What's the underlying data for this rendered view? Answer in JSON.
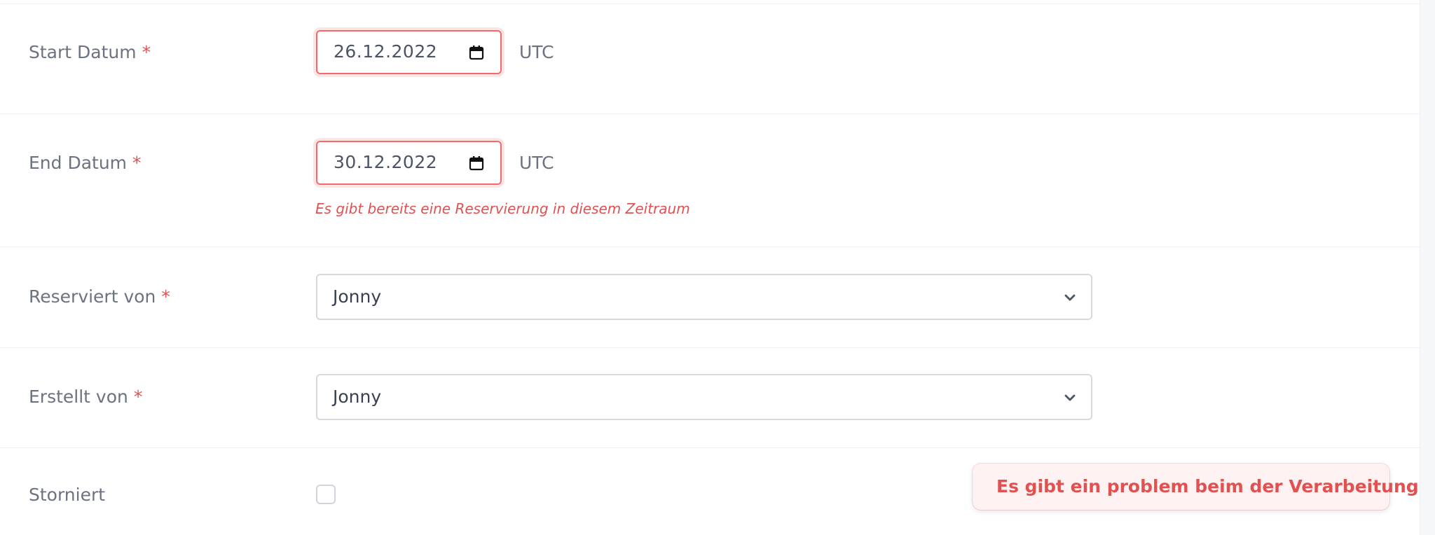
{
  "form": {
    "start_date": {
      "label": "Start Datum",
      "required_mark": "*",
      "value": "26.12.2022",
      "unit": "UTC"
    },
    "end_date": {
      "label": "End Datum",
      "required_mark": "*",
      "value": "30.12.2022",
      "unit": "UTC",
      "error": "Es gibt bereits eine Reservierung in diesem Zeitraum"
    },
    "reserved_by": {
      "label": "Reserviert von",
      "required_mark": "*",
      "value": "Jonny"
    },
    "created_by": {
      "label": "Erstellt von",
      "required_mark": "*",
      "value": "Jonny"
    },
    "cancelled": {
      "label": "Storniert",
      "checked": false
    }
  },
  "toast": {
    "message": "Es gibt ein problem beim der Verarbeitung"
  },
  "colors": {
    "error": "#e05252",
    "label": "#6b7280",
    "input_border": "#d5d9e0",
    "error_border": "#f26b6b"
  },
  "icons": {
    "date_picker": "calendar-icon",
    "select_toggle": "chevron-down-icon"
  }
}
